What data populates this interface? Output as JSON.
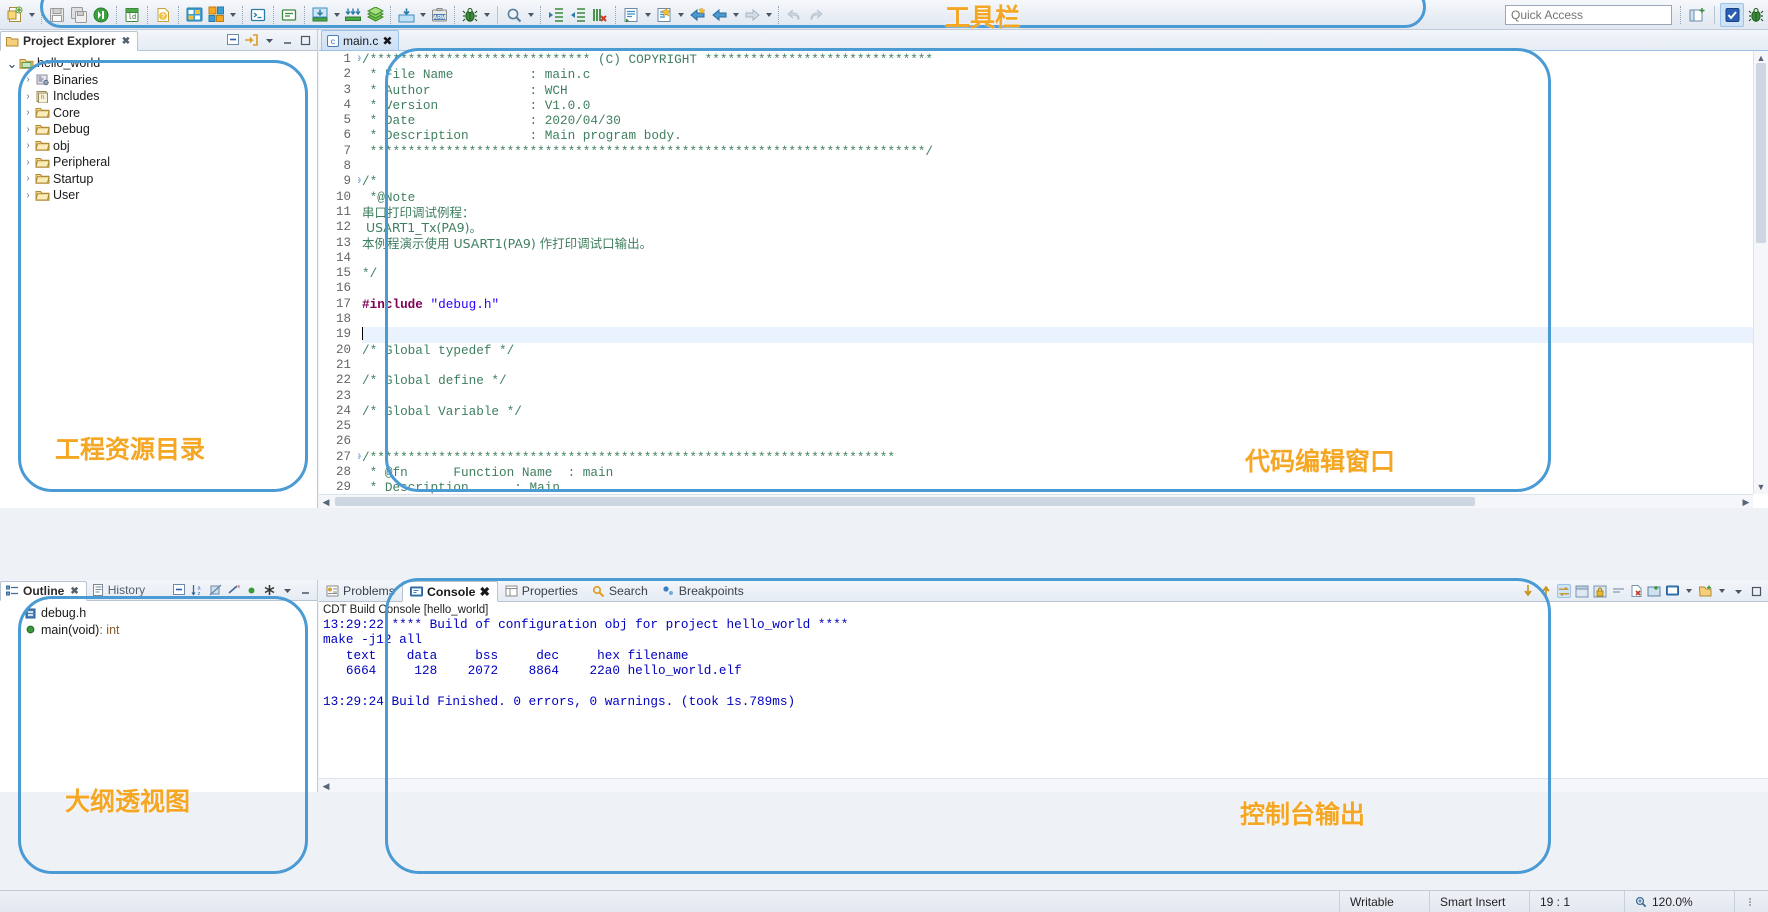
{
  "toolbar": {
    "quick_access_placeholder": "Quick Access",
    "groups": [
      {
        "name": "new-group",
        "items": [
          {
            "icon": "new-file-icon",
            "label": "New",
            "dropdown": true
          },
          {
            "icon": "save-icon",
            "label": "Save",
            "dropdown": false
          },
          {
            "icon": "save-all-icon",
            "label": "Save All",
            "dropdown": false
          },
          {
            "icon": "download-program-icon",
            "label": "Download",
            "dropdown": false
          }
        ]
      },
      {
        "name": "ld-group",
        "items": [
          {
            "icon": "linker-script-icon",
            "label": "Linker Script",
            "dropdown": false
          }
        ]
      },
      {
        "name": "help-group",
        "items": [
          {
            "icon": "help-icon",
            "label": "Help",
            "dropdown": false
          }
        ]
      },
      {
        "name": "build-group",
        "items": [
          {
            "icon": "build-icon",
            "label": "Build",
            "dropdown": false
          },
          {
            "icon": "build-configs-icon",
            "label": "Build Configurations",
            "dropdown": true
          }
        ]
      },
      {
        "name": "terminal-group",
        "items": [
          {
            "icon": "terminal-icon",
            "label": "Terminal",
            "dropdown": false
          }
        ]
      },
      {
        "name": "monitor-group",
        "items": [
          {
            "icon": "serial-monitor-icon",
            "label": "Serial Monitor",
            "dropdown": false
          }
        ]
      },
      {
        "name": "download-group",
        "items": [
          {
            "icon": "download-icon",
            "label": "Download",
            "dropdown": true
          },
          {
            "icon": "download-all-icon",
            "label": "Download All",
            "dropdown": false
          },
          {
            "icon": "library-icon",
            "label": "Library",
            "dropdown": false
          }
        ]
      },
      {
        "name": "flash-group",
        "items": [
          {
            "icon": "flash-icon",
            "label": "Flash",
            "dropdown": true
          },
          {
            "icon": "arm-icon",
            "label": "ARM",
            "dropdown": false
          }
        ]
      },
      {
        "name": "debug-group",
        "items": [
          {
            "icon": "debug-bug-icon",
            "label": "Debug",
            "dropdown": true
          }
        ]
      },
      {
        "name": "search-group",
        "items": [
          {
            "icon": "search-icon",
            "label": "Search",
            "dropdown": true
          }
        ]
      },
      {
        "name": "indent-group",
        "items": [
          {
            "icon": "indent-right-icon",
            "label": "Indent Right",
            "dropdown": false
          },
          {
            "icon": "indent-left-icon",
            "label": "Indent Left",
            "dropdown": false
          },
          {
            "icon": "remove-comment-icon",
            "label": "Remove Comment",
            "dropdown": false
          }
        ]
      },
      {
        "name": "run-group",
        "items": [
          {
            "icon": "run-last-tool-icon",
            "label": "Run Last Tool",
            "dropdown": true
          },
          {
            "icon": "external-tools-icon",
            "label": "External Tools",
            "dropdown": true
          }
        ]
      },
      {
        "name": "nav-group",
        "items": [
          {
            "icon": "back-to-icon",
            "label": "Back To",
            "dropdown": false
          },
          {
            "icon": "back-icon",
            "label": "Back",
            "dropdown": true
          },
          {
            "icon": "forward-icon",
            "label": "Forward",
            "dropdown": true
          }
        ]
      },
      {
        "name": "undo-group",
        "items": [
          {
            "icon": "undo-icon",
            "label": "Undo",
            "dropdown": false
          },
          {
            "icon": "redo-icon",
            "label": "Redo",
            "dropdown": false
          }
        ]
      }
    ],
    "right": [
      {
        "icon": "open-perspective-icon",
        "label": "Open Perspective"
      },
      {
        "icon": "mrs-perspective-icon",
        "label": "MRS Perspective",
        "active": true
      },
      {
        "icon": "debug-perspective-icon",
        "label": "Debug Perspective",
        "active": false
      }
    ]
  },
  "project_explorer": {
    "title": "Project Explorer",
    "tools": [
      {
        "icon": "collapse-all-icon",
        "label": "Collapse All"
      },
      {
        "icon": "link-with-editor-icon",
        "label": "Link with Editor"
      },
      {
        "icon": "view-menu-icon",
        "label": "View Menu"
      },
      {
        "icon": "minimize-icon",
        "label": "Minimize"
      },
      {
        "icon": "maximize-icon",
        "label": "Maximize"
      }
    ],
    "tree": [
      {
        "label": "hello_world",
        "icon": "c-project-icon",
        "depth": 0,
        "expanded": true
      },
      {
        "label": "Binaries",
        "icon": "binaries-icon",
        "depth": 1,
        "expanded": false
      },
      {
        "label": "Includes",
        "icon": "includes-icon",
        "depth": 1,
        "expanded": false
      },
      {
        "label": "Core",
        "icon": "folder-icon",
        "depth": 1,
        "expanded": false
      },
      {
        "label": "Debug",
        "icon": "folder-icon",
        "depth": 1,
        "expanded": false
      },
      {
        "label": "obj",
        "icon": "folder-icon",
        "depth": 1,
        "expanded": false
      },
      {
        "label": "Peripheral",
        "icon": "folder-icon",
        "depth": 1,
        "expanded": false
      },
      {
        "label": "Startup",
        "icon": "folder-icon",
        "depth": 1,
        "expanded": false
      },
      {
        "label": "User",
        "icon": "folder-icon",
        "depth": 1,
        "expanded": false
      }
    ]
  },
  "outline": {
    "tabs": [
      {
        "label": "Outline",
        "icon": "outline-icon",
        "active": true,
        "closable": true
      },
      {
        "label": "History",
        "icon": "history-icon",
        "active": false,
        "closable": false
      }
    ],
    "tools": [
      {
        "icon": "collapse-all-icon",
        "label": "Collapse All"
      },
      {
        "icon": "sort-icon",
        "label": "Sort"
      },
      {
        "icon": "hide-fields-icon",
        "label": "Hide Fields"
      },
      {
        "icon": "hide-static-icon",
        "label": "Hide Static Members"
      },
      {
        "icon": "hide-nonpublic-icon",
        "label": "Hide Non-Public Members"
      },
      {
        "icon": "focus-icon",
        "label": "Focus On Active Task"
      },
      {
        "icon": "view-menu-icon",
        "label": "View Menu"
      },
      {
        "icon": "minimize-icon",
        "label": "Minimize"
      }
    ],
    "items": [
      {
        "label": "debug.h",
        "icon": "include-icon",
        "type": ""
      },
      {
        "label": "main(void)",
        "icon": "function-icon",
        "type": " : int"
      }
    ]
  },
  "editor": {
    "tab": {
      "label": "main.c",
      "icon": "c-file-icon",
      "closable": true,
      "active": true
    },
    "first_line_number": 1,
    "cursor_line": 19,
    "lines": [
      {
        "n": 1,
        "fold": "open",
        "segments": [
          {
            "t": "/***************************** (C) COPYRIGHT ******************************",
            "c": "cmt"
          }
        ]
      },
      {
        "n": 2,
        "segments": [
          {
            "t": " * File Name          : main.c",
            "c": "cmt"
          }
        ]
      },
      {
        "n": 3,
        "segments": [
          {
            "t": " * Author             : WCH",
            "c": "cmt"
          }
        ]
      },
      {
        "n": 4,
        "segments": [
          {
            "t": " * Version            : V1.0.0",
            "c": "cmt"
          }
        ]
      },
      {
        "n": 5,
        "segments": [
          {
            "t": " * Date               : 2020/04/30",
            "c": "cmt"
          }
        ]
      },
      {
        "n": 6,
        "segments": [
          {
            "t": " * Description        : Main program body.",
            "c": "cmt"
          }
        ]
      },
      {
        "n": 7,
        "segments": [
          {
            "t": " *************************************************************************/",
            "c": "cmt"
          }
        ]
      },
      {
        "n": 8,
        "segments": []
      },
      {
        "n": 9,
        "fold": "open",
        "segments": [
          {
            "t": "/*",
            "c": "cmt"
          }
        ]
      },
      {
        "n": 10,
        "segments": [
          {
            "t": " *@Note",
            "c": "cmt"
          }
        ]
      },
      {
        "n": 11,
        "segments": [
          {
            "t": "串口打印调试例程：",
            "c": "cjk"
          }
        ]
      },
      {
        "n": 12,
        "segments": [
          {
            "t": " USART1_Tx(PA9)。",
            "c": "cjk"
          }
        ]
      },
      {
        "n": 13,
        "segments": [
          {
            "t": "本例程演示使用 USART1(PA9) 作打印调试口输出。",
            "c": "cjk"
          }
        ]
      },
      {
        "n": 14,
        "segments": []
      },
      {
        "n": 15,
        "segments": [
          {
            "t": "*/",
            "c": "cmt"
          }
        ]
      },
      {
        "n": 16,
        "segments": []
      },
      {
        "n": 17,
        "segments": [
          {
            "t": "#include ",
            "c": "pp"
          },
          {
            "t": "\"debug.h\"",
            "c": "str"
          }
        ]
      },
      {
        "n": 18,
        "segments": []
      },
      {
        "n": 19,
        "highlight": true,
        "caret": true,
        "segments": []
      },
      {
        "n": 20,
        "segments": [
          {
            "t": "/* Global typedef */",
            "c": "cmt"
          }
        ]
      },
      {
        "n": 21,
        "segments": []
      },
      {
        "n": 22,
        "segments": [
          {
            "t": "/* Global define */",
            "c": "cmt"
          }
        ]
      },
      {
        "n": 23,
        "segments": []
      },
      {
        "n": 24,
        "segments": [
          {
            "t": "/* Global Variable */",
            "c": "cmt"
          }
        ]
      },
      {
        "n": 25,
        "segments": []
      },
      {
        "n": 26,
        "segments": []
      },
      {
        "n": 27,
        "fold": "open",
        "segments": [
          {
            "t": "/*********************************************************************",
            "c": "cmt"
          }
        ]
      },
      {
        "n": 28,
        "segments": [
          {
            "t": " * @fn      Function Name  : main",
            "c": "cmt"
          }
        ]
      },
      {
        "n": 29,
        "segments": [
          {
            "t": " * Description      : Main",
            "c": "cmt"
          }
        ]
      }
    ]
  },
  "console": {
    "tabs": [
      {
        "label": "Problems",
        "icon": "problems-icon",
        "active": false,
        "closable": false
      },
      {
        "label": "Console",
        "icon": "console-icon",
        "active": true,
        "closable": true
      },
      {
        "label": "Properties",
        "icon": "properties-icon",
        "active": false,
        "closable": false
      },
      {
        "label": "Search",
        "icon": "search-view-icon",
        "active": false,
        "closable": false
      },
      {
        "label": "Breakpoints",
        "icon": "breakpoints-icon",
        "active": false,
        "closable": false
      }
    ],
    "tools": [
      {
        "icon": "scroll-lock-down-icon",
        "label": "Scroll Down"
      },
      {
        "icon": "scroll-lock-up-icon",
        "label": "Scroll Up"
      },
      {
        "icon": "toggle-wrap-icon",
        "label": "Word Wrap",
        "active": true
      },
      {
        "icon": "pin-console-icon",
        "label": "Pin Console"
      },
      {
        "icon": "lock-scroll-icon",
        "label": "Scroll Lock"
      },
      {
        "icon": "clear-icon",
        "label": "Clear Console"
      },
      {
        "icon": "remove-console-icon",
        "label": "Remove Console"
      },
      {
        "icon": "display-console-icon",
        "label": "Display Selected Console"
      },
      {
        "icon": "open-console-icon",
        "label": "Open Console",
        "dropdown": true
      },
      {
        "icon": "new-console-icon",
        "label": "New Console View",
        "dropdown": true
      },
      {
        "icon": "view-menu-icon",
        "label": "View Menu"
      },
      {
        "icon": "maximize-icon",
        "label": "Maximize"
      }
    ],
    "title": "CDT Build Console [hello_world]",
    "lines": [
      "13:29:22 **** Build of configuration obj for project hello_world ****",
      "make -j12 all ",
      "   text\t   data\t    bss\t    dec\t    hex\tfilename",
      "   6664\t    128\t   2072\t   8864\t   22a0\thello_world.elf",
      "",
      "13:29:24 Build Finished. 0 errors, 0 warnings. (took 1s.789ms)"
    ]
  },
  "statusbar": {
    "writable": "Writable",
    "insert_mode": "Smart Insert",
    "position": "19 : 1",
    "zoom": "120.0%",
    "zoom_icon": "zoom-icon"
  },
  "annotations": [
    {
      "id": "toolbar",
      "text": "工具栏"
    },
    {
      "id": "project",
      "text": "工程资源目录"
    },
    {
      "id": "editor",
      "text": "代码编辑窗口"
    },
    {
      "id": "outline",
      "text": "大纲透视图"
    },
    {
      "id": "console",
      "text": "控制台输出"
    }
  ],
  "colors": {
    "annotation_box": "#4a9ad4",
    "annotation_text": "#f5a623",
    "comment": "#3f7f5f",
    "preprocessor": "#7f0055",
    "string": "#2a00ff",
    "console_text": "#0000c0"
  }
}
